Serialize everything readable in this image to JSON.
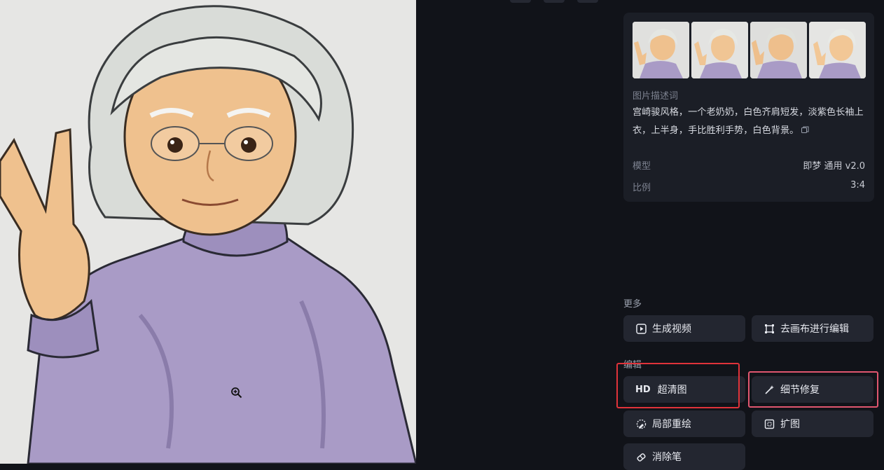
{
  "image": {
    "alt": "宫崎骏风格，一个老奶奶，白色齐肩短发，淡紫色长袖上衣，上半身，手比胜利手势，白色背景。"
  },
  "info": {
    "desc_label": "图片描述词",
    "desc_text": "宫崎骏风格，一个老奶奶，白色齐肩短发，淡紫色长袖上衣，上半身，手比胜利手势，白色背景。",
    "model_label": "模型",
    "model_value": "即梦 通用 v2.0",
    "ratio_label": "比例",
    "ratio_value": "3:4"
  },
  "more": {
    "label": "更多",
    "generate_video": "生成视频",
    "edit_canvas": "去画布进行编辑"
  },
  "edit": {
    "label": "编辑",
    "hd_tag": "HD",
    "super_res": "超清图",
    "detail_fix": "细节修复",
    "inpaint": "局部重绘",
    "expand": "扩图",
    "eraser": "消除笔"
  },
  "colors": {
    "background": "#111319",
    "card": "#1b1e26",
    "button": "#232630",
    "highlight": "#e0333a",
    "sweater": "#a99bc6"
  }
}
